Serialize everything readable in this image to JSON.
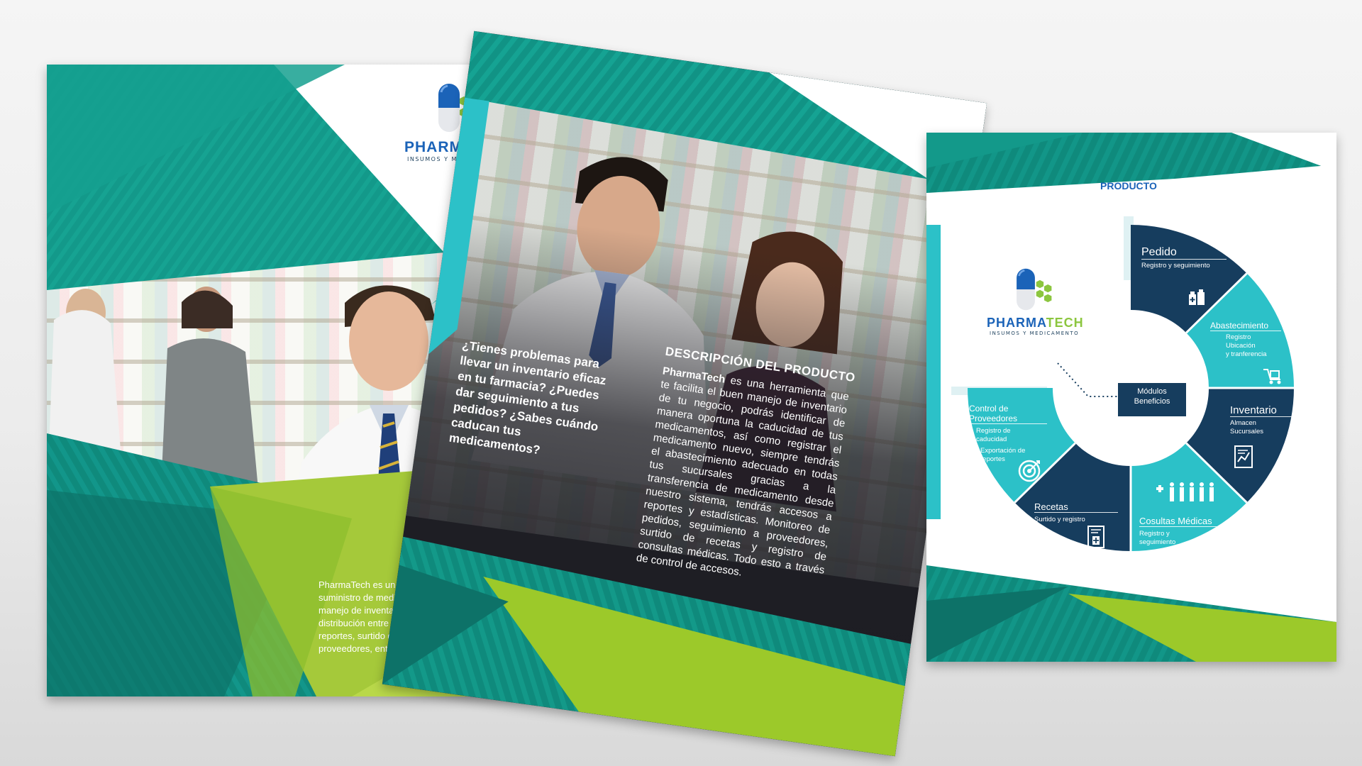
{
  "brand": {
    "name_part1": "PHARMA",
    "name_part2": "TECH",
    "tagline": "INSUMOS Y MEDICAMENTO"
  },
  "colors": {
    "teal_dark": "#0f7d72",
    "teal": "#16a392",
    "cyan": "#2cc1c8",
    "lime": "#9cc92a",
    "navy": "#163d5e",
    "capsule_blue": "#1b63b8",
    "hex_green": "#8cc63f"
  },
  "panel_front": {
    "body_text": "PharmaTech es un sistema de control y suministro de medicamento para facilitar el manejo de inventario y abastecimiento, distribución entre sucursales, dándote reportes, surtido de recetas, seguimiento de proveedores, entre otros.",
    "icons": [
      "capsule-icon",
      "hexagon-cluster-icon"
    ]
  },
  "panel_inner": {
    "question_text": "¿Tienes problemas para llevar un inventario eficaz en tu farmacia? ¿Puedes dar seguimiento a tus pedidos? ¿Sabes cuándo caducan tus medicamentos?",
    "desc_title": "DESCRIPCIÓN DEL PRODUCTO",
    "desc_brand": "PharmaTech",
    "desc_body": " es una herramienta que te facilita el buen manejo de inventario de tu negocio, podrás identificar de manera oportuna la caducidad de tus medicamentos, así como registrar el medicamento nuevo, siempre tendrás el abastecimiento adecuado en todas tus sucursales gracias a la transferencia de medicamento desde nuestro sistema, tendrás accesos a reportes y estadísticas. Monitoreo de pedidos, seguimiento a proveedores, surtido de recetas y registro de consultas médicas. Todo esto a través de control de accesos."
  },
  "panel_product": {
    "title": "PRODUCTO",
    "center": {
      "line1": "Módulos",
      "line2": "Beneficios"
    },
    "segments": [
      {
        "title": "Pedido",
        "sub": [
          "Registro y seguimiento"
        ],
        "icon": "medicine-bottles-icon",
        "color": "#163d5e"
      },
      {
        "title": "Abastecimiento",
        "sub": [
          "Registro",
          "Ubicación",
          "y tranferencia"
        ],
        "icon": "delivery-cart-icon",
        "color": "#2cc1c8"
      },
      {
        "title": "Inventario",
        "sub": [
          "Almacen",
          "Sucursales"
        ],
        "icon": "report-chart-icon",
        "color": "#163d5e"
      },
      {
        "title": "Cosultas Médicas",
        "sub": [
          "Registro y",
          "seguimiento"
        ],
        "icon": "people-medical-icon",
        "color": "#2cc1c8"
      },
      {
        "title": "Recetas",
        "sub": [
          "Surtido y registro"
        ],
        "icon": "prescription-icon",
        "color": "#163d5e"
      },
      {
        "title": "Control de",
        "title2": "Proveedores",
        "sub": [
          "Registro de",
          "caducidad"
        ],
        "sub2": [
          "Exportación de",
          "reportes"
        ],
        "icon": "target-icon",
        "color": "#2cc1c8"
      }
    ]
  }
}
